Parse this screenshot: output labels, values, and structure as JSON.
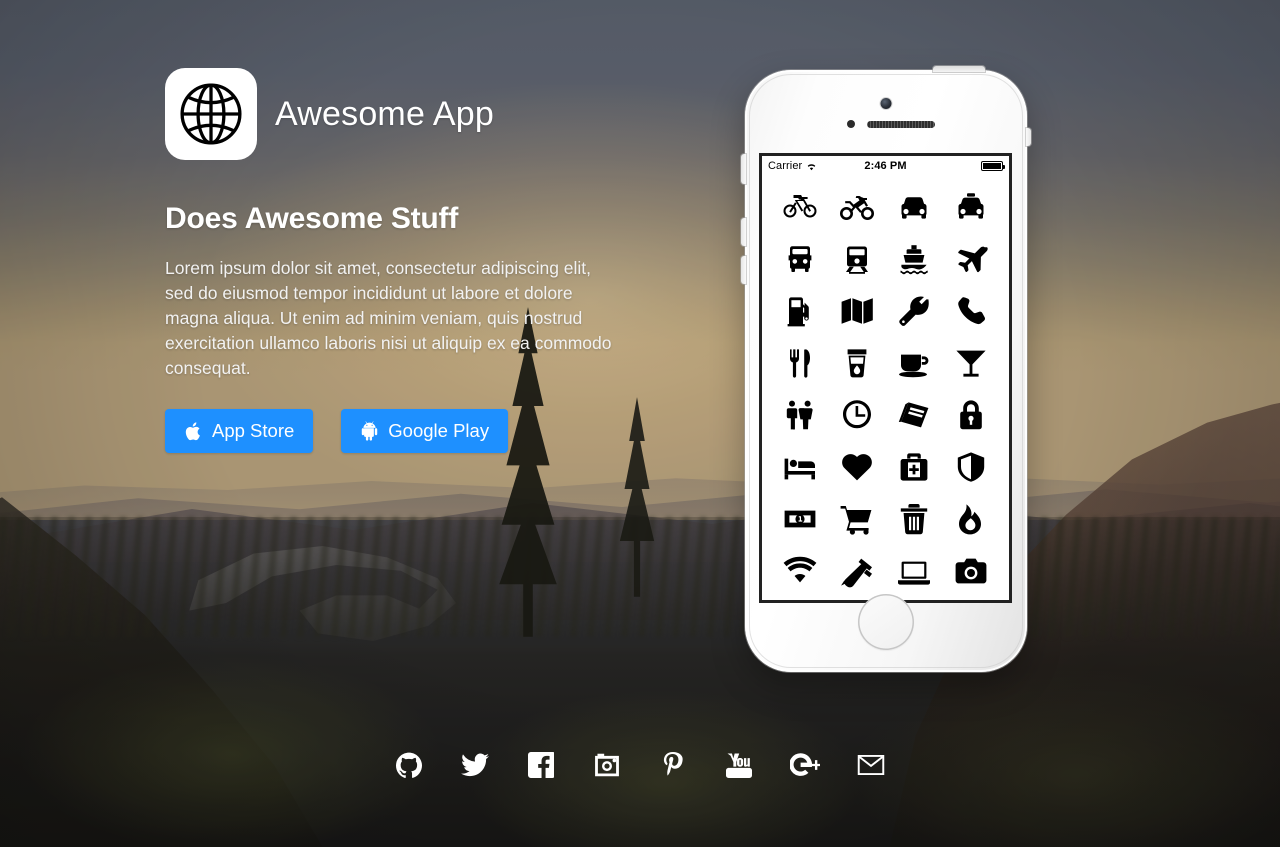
{
  "app": {
    "icon_name": "globe-icon",
    "title": "Awesome App"
  },
  "hero": {
    "headline": "Does Awesome Stuff",
    "paragraph": "Lorem ipsum dolor sit amet, consectetur adipiscing elit, sed do eiusmod tempor incididunt ut labore et dolore magna aliqua. Ut enim ad minim veniam, quis nostrud exercitation ullamco laboris nisi ut aliquip ex ea commodo consequat."
  },
  "cta": {
    "accent_color": "#1e90ff",
    "buttons": [
      {
        "label": "App Store",
        "icon": "apple-icon"
      },
      {
        "label": "Google Play",
        "icon": "android-icon"
      }
    ]
  },
  "phone": {
    "device": "iphone-white",
    "status_bar": {
      "carrier": "Carrier",
      "wifi_icon": "wifi-icon",
      "time": "2:46 PM",
      "battery_icon": "battery-full-icon"
    },
    "screen": {
      "icon_grid_rows": 8,
      "icon_grid_columns": 4,
      "icons": [
        "bicycle-icon",
        "motorcycle-icon",
        "car-icon",
        "taxi-icon",
        "bus-icon",
        "train-icon",
        "ship-icon",
        "airplane-icon",
        "gas-pump-icon",
        "map-icon",
        "wrench-icon",
        "phone-icon",
        "restaurant-icon",
        "water-glass-icon",
        "coffee-icon",
        "cocktail-icon",
        "restroom-icon",
        "clock-icon",
        "book-icon",
        "lock-icon",
        "bed-icon",
        "heart-icon",
        "first-aid-kit-icon",
        "shield-icon",
        "money-icon",
        "shopping-cart-icon",
        "trash-icon",
        "fire-icon",
        "wifi-signal-icon",
        "power-plug-icon",
        "laptop-icon",
        "camera-icon"
      ]
    },
    "home_button": "home-button"
  },
  "social": {
    "links": [
      {
        "name": "github-icon",
        "label": "GitHub"
      },
      {
        "name": "twitter-icon",
        "label": "Twitter"
      },
      {
        "name": "facebook-icon",
        "label": "Facebook"
      },
      {
        "name": "instagram-icon",
        "label": "Instagram"
      },
      {
        "name": "pinterest-icon",
        "label": "Pinterest"
      },
      {
        "name": "youtube-icon",
        "label": "YouTube"
      },
      {
        "name": "googleplus-icon",
        "label": "Google Plus"
      },
      {
        "name": "email-icon",
        "label": "Email"
      }
    ]
  }
}
